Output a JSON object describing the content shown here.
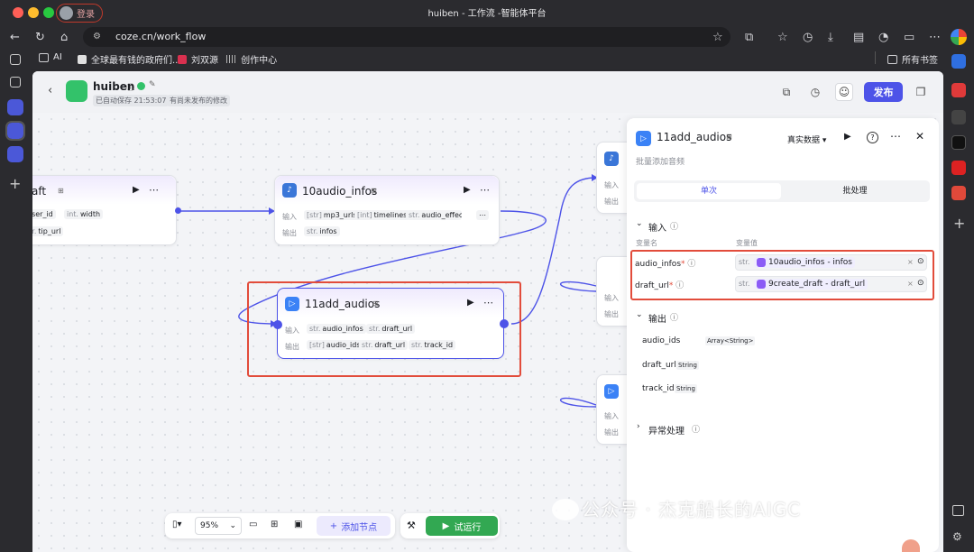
{
  "browser": {
    "login_label": "登录",
    "window_title": "huiben - 工作流 -智能体平台",
    "url": "coze.cn/work_flow",
    "bookmarks": [
      "AI",
      "全球最有钱的政府们...",
      "刘双源",
      "创作中心"
    ],
    "all_bookmarks": "所有书签"
  },
  "header": {
    "app_name": "huiben",
    "saved_text": "已自动保存 21:53:07",
    "unpublished_text": "有尚未发布的修改",
    "publish_label": "发布"
  },
  "nodes": {
    "draft": {
      "title": "aft",
      "inputs": [
        {
          "type": "",
          "name": "user_id"
        },
        {
          "type": "int.",
          "name": "width"
        }
      ],
      "outputs": [
        {
          "type": "str.",
          "name": "tip_url"
        }
      ]
    },
    "audio_infos": {
      "title": "10audio_infos",
      "input_label": "输入",
      "output_label": "输出",
      "inputs": [
        {
          "type": "[str]",
          "name": "mp3_urls"
        },
        {
          "type": "[int]",
          "name": "timelines"
        },
        {
          "type": "str.",
          "name": "audio_effect"
        }
      ],
      "outputs": [
        {
          "type": "str.",
          "name": "infos"
        }
      ]
    },
    "add_audios": {
      "title": "11add_audios",
      "input_label": "输入",
      "output_label": "输出",
      "inputs": [
        {
          "type": "str.",
          "name": "audio_infos"
        },
        {
          "type": "str.",
          "name": "draft_url"
        }
      ],
      "outputs": [
        {
          "type": "[str]",
          "name": "audio_ids"
        },
        {
          "type": "str.",
          "name": "draft_url"
        },
        {
          "type": "str.",
          "name": "track_id"
        }
      ]
    },
    "right_partial_a": {
      "input_label": "输入",
      "output_label": "输出"
    },
    "right_partial_b": {
      "input_label": "输入",
      "output_label": "输出"
    },
    "right_partial_c": {
      "input_label": "输入",
      "output_label": "输出"
    }
  },
  "panel": {
    "title": "11add_audios",
    "mode_select": "真实数据",
    "description": "批量添加音频",
    "tabs": [
      "单次",
      "批处理"
    ],
    "input_section": "输入",
    "col_name": "变量名",
    "col_value": "变量值",
    "input_rows": [
      {
        "name": "audio_infos",
        "type": "str.",
        "ref": "10audio_infos - infos"
      },
      {
        "name": "draft_url",
        "type": "str.",
        "ref": "9create_draft - draft_url"
      }
    ],
    "output_section": "输出",
    "output_rows": [
      {
        "name": "audio_ids",
        "type": "Array<String>"
      },
      {
        "name": "draft_url",
        "type": "String"
      },
      {
        "name": "track_id",
        "type": "String"
      }
    ],
    "exception_section": "异常处理"
  },
  "toolbar": {
    "zoom": "95%",
    "add_node": "添加节点",
    "run": "试运行"
  },
  "watermark": "公众号 · 杰克船长的AIGC",
  "colors": {
    "accent": "#4d53e8",
    "run": "#32a852",
    "highlight": "#e24c3b"
  }
}
